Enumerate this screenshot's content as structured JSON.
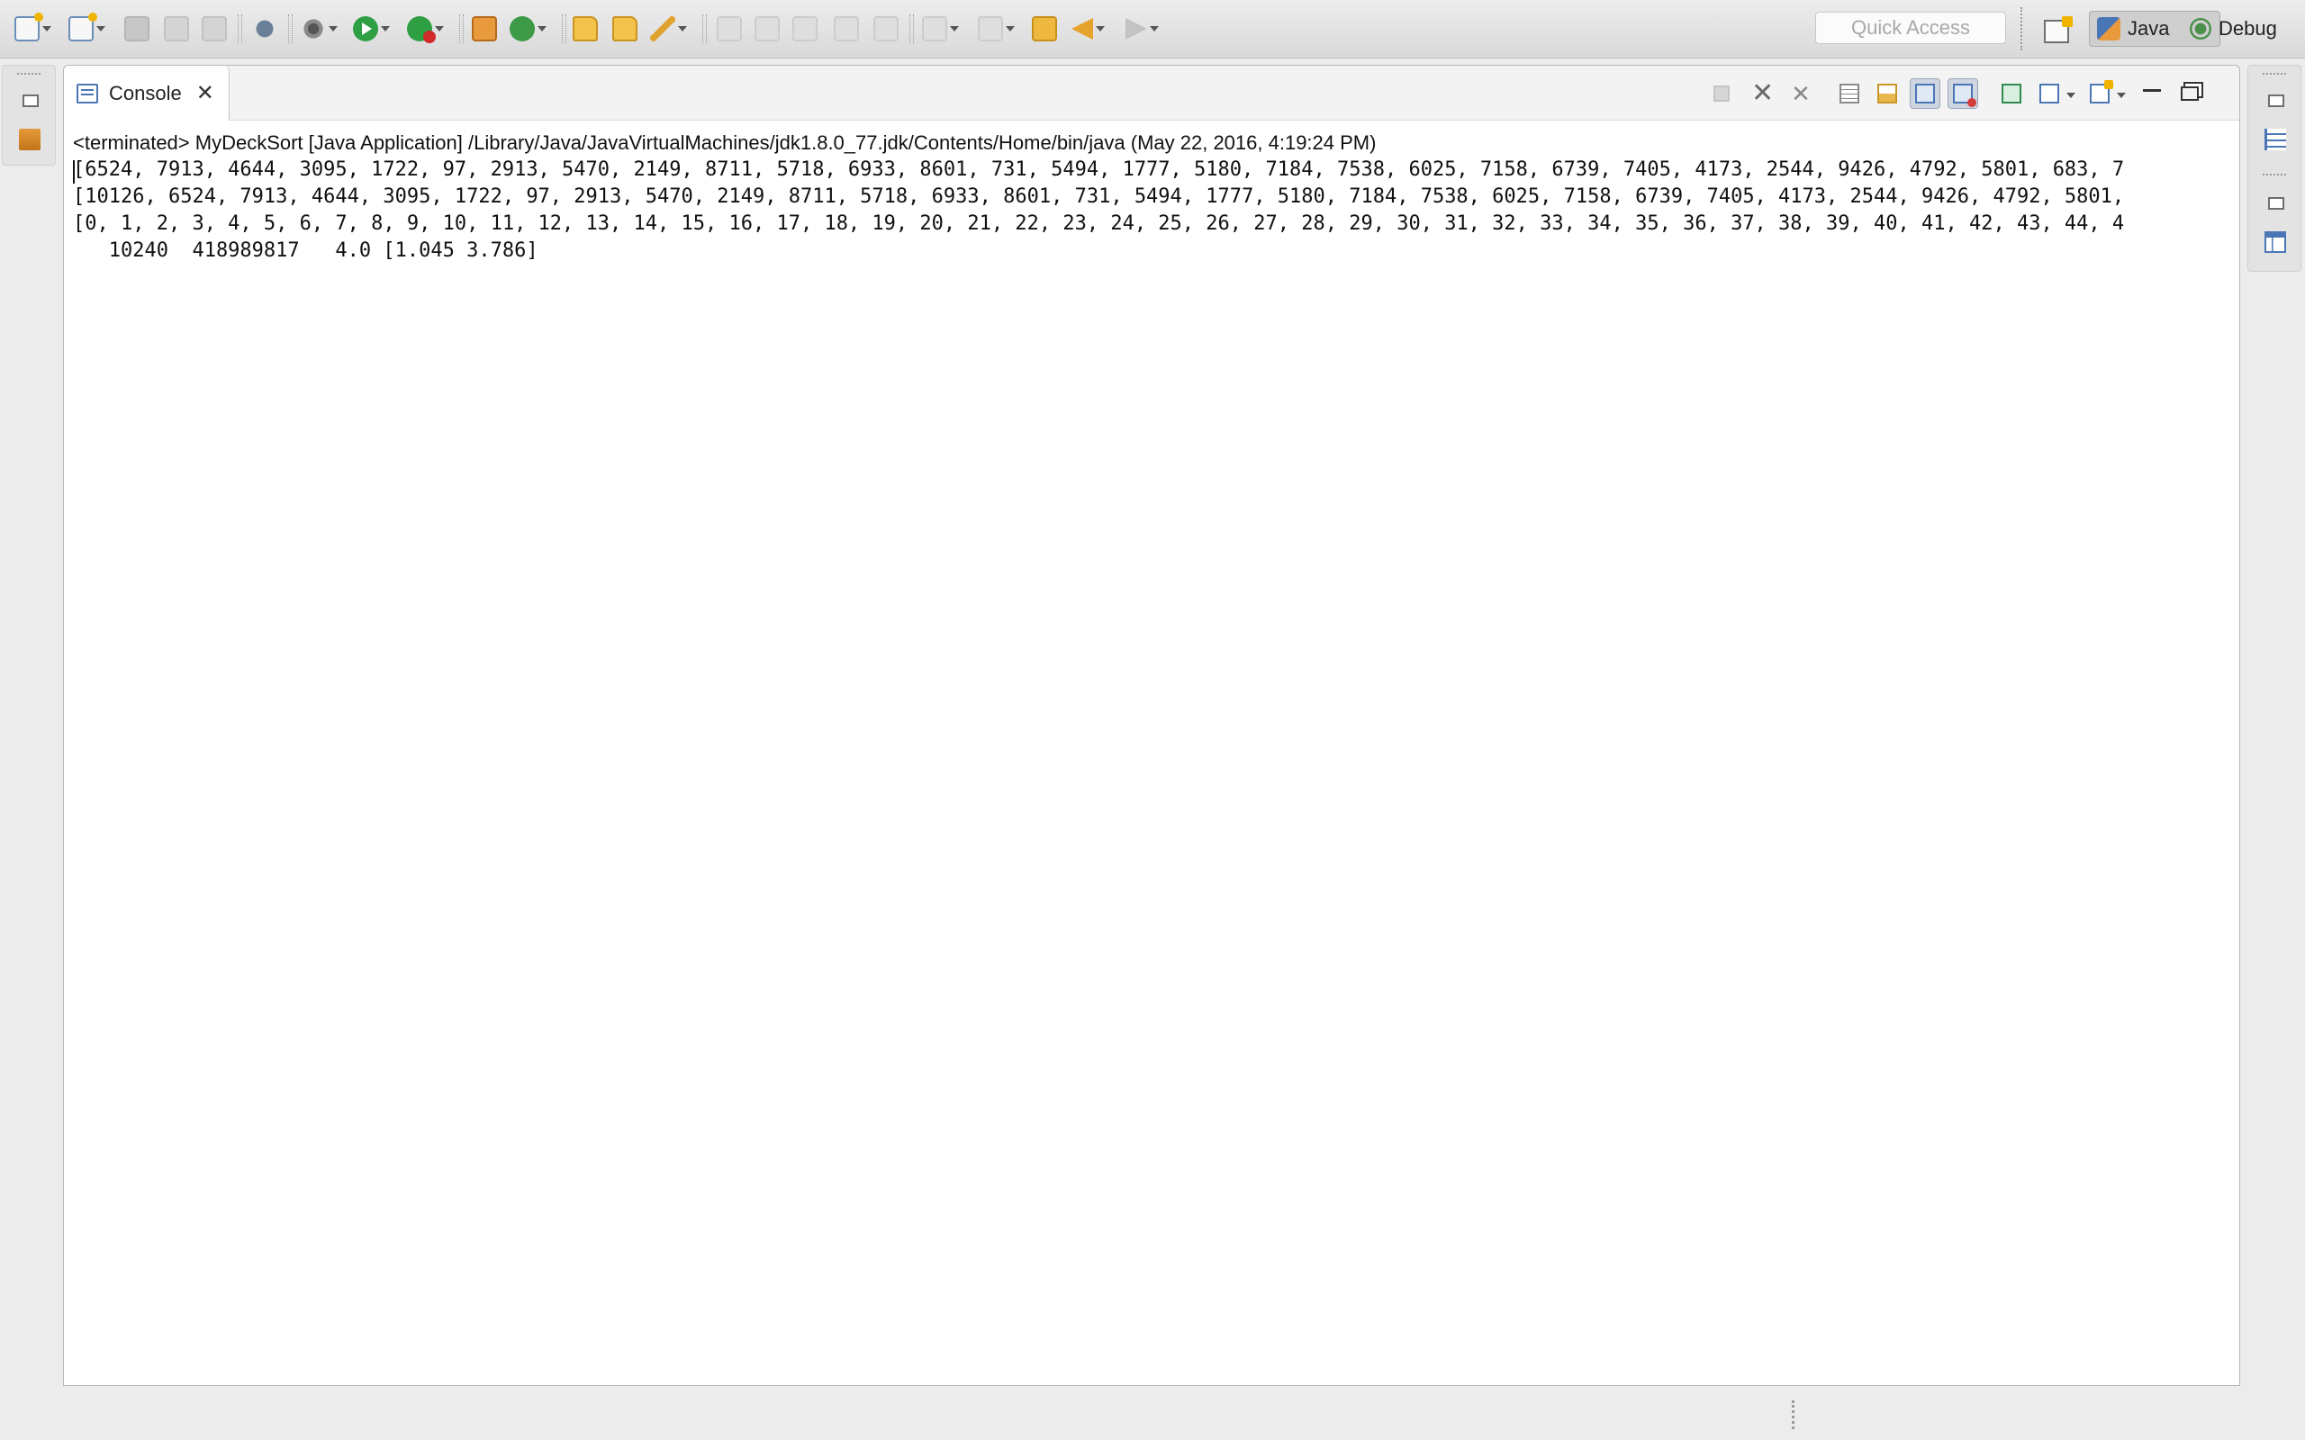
{
  "toolbar": {
    "quick_access_placeholder": "Quick Access",
    "perspectives": [
      {
        "label": "Java",
        "icon": "java-perspective-icon",
        "active": true
      },
      {
        "label": "Debug",
        "icon": "debug-perspective-icon",
        "active": false
      }
    ]
  },
  "console": {
    "tab_label": "Console",
    "status": "<terminated> MyDeckSort [Java Application] /Library/Java/JavaVirtualMachines/jdk1.8.0_77.jdk/Contents/Home/bin/java (May 22, 2016, 4:19:24 PM)",
    "output_lines": [
      "[6524, 7913, 4644, 3095, 1722, 97, 2913, 5470, 2149, 8711, 5718, 6933, 8601, 731, 5494, 1777, 5180, 7184, 7538, 6025, 7158, 6739, 7405, 4173, 2544, 9426, 4792, 5801, 683, 7",
      "[10126, 6524, 7913, 4644, 3095, 1722, 97, 2913, 5470, 2149, 8711, 5718, 6933, 8601, 731, 5494, 1777, 5180, 7184, 7538, 6025, 7158, 6739, 7405, 4173, 2544, 9426, 4792, 5801,",
      "[0, 1, 2, 3, 4, 5, 6, 7, 8, 9, 10, 11, 12, 13, 14, 15, 16, 17, 18, 19, 20, 21, 22, 23, 24, 25, 26, 27, 28, 29, 30, 31, 32, 33, 34, 35, 36, 37, 38, 39, 40, 41, 42, 43, 44, 4",
      "   10240  418989817   4.0 [1.045 3.786]"
    ]
  },
  "colors": {
    "toolbar_bg": "#e2e2e2",
    "window_bg": "#ececec",
    "console_bg": "#ffffff",
    "accent_blue": "#4b76b5"
  }
}
